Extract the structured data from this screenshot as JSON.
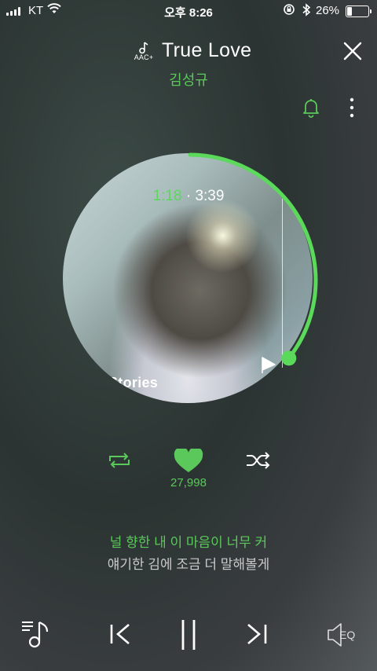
{
  "status_bar": {
    "carrier": "KT",
    "time": "오후 8:26",
    "battery_percent": "26%",
    "battery_level": 0.26,
    "icons": [
      "signal-icon",
      "wifi-icon",
      "orientation-lock-icon",
      "bluetooth-icon",
      "battery-icon"
    ]
  },
  "header": {
    "quality_badge": "AAC+",
    "title": "True Love",
    "artist": "김성규",
    "icons": [
      "aac-plus-icon",
      "close-icon",
      "bell-icon",
      "more-icon"
    ]
  },
  "player": {
    "current_time": "1:18",
    "separator": "·",
    "total_time": "3:39",
    "progress": 0.356,
    "album_text": "Stories"
  },
  "actions": {
    "like_count": "27,998",
    "icons": [
      "repeat-icon",
      "heart-icon",
      "shuffle-icon"
    ]
  },
  "lyrics": {
    "current_line": "널 향한 내 이 마음이 너무 커",
    "next_line": "얘기한 김에 조금 더 말해볼게"
  },
  "bottom_bar": {
    "eq_label": "EQ",
    "icons": [
      "playlist-icon",
      "previous-icon",
      "pause-icon",
      "next-icon",
      "eq-icon"
    ]
  },
  "colors": {
    "accent": "#5ac85a",
    "text": "#ffffff",
    "lyric_secondary": "#c9c9c9"
  }
}
